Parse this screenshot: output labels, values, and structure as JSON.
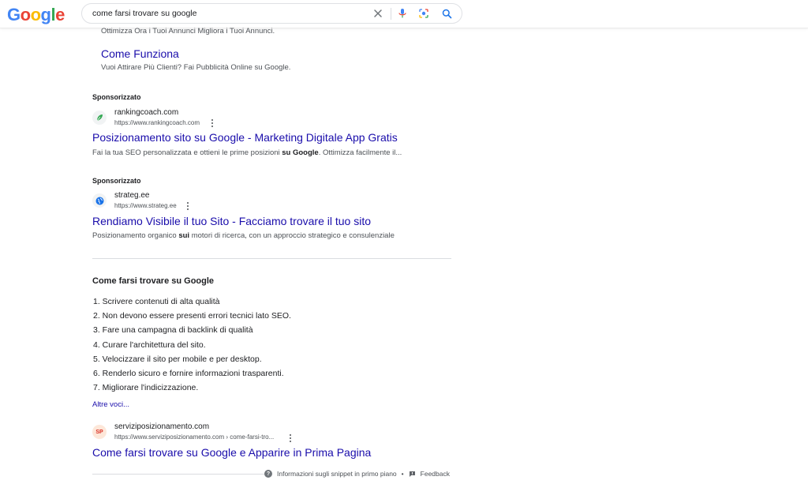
{
  "header": {
    "logo_letters": [
      {
        "char": "G",
        "color": "#4285F4"
      },
      {
        "char": "o",
        "color": "#EA4335"
      },
      {
        "char": "o",
        "color": "#FBBC05"
      },
      {
        "char": "g",
        "color": "#4285F4"
      },
      {
        "char": "l",
        "color": "#34A853"
      },
      {
        "char": "e",
        "color": "#EA4335"
      }
    ],
    "search": {
      "value": "come farsi trovare su google",
      "icons": [
        "clear-icon",
        "microphone-icon",
        "camera-lens-icon",
        "search-icon"
      ]
    }
  },
  "sitelinks": {
    "top_desc": "Ottimizza Ora i Tuoi Annunci Migliora i Tuoi Annunci.",
    "title": "Come Funziona",
    "desc": "Vuoi Attirare Più Clienti? Fai Pubblicità Online su Google."
  },
  "ads": [
    {
      "sponsored": "Sponsorizzato",
      "site": "rankingcoach.com",
      "url": "https://www.rankingcoach.com",
      "title": "Posizionamento sito su Google - Marketing Digitale App Gratis",
      "desc_pre": "Fai la tua SEO personalizzata e ottieni le prime posizioni ",
      "desc_bold": "su Google",
      "desc_post": ". Ottimizza facilmente il...",
      "favicon": "leaf-icon",
      "favicon_color": "#34A853"
    },
    {
      "sponsored": "Sponsorizzato",
      "site": "strateg.ee",
      "url": "https://www.strateg.ee",
      "title": "Rendiamo Visibile il tuo Sito - Facciamo trovare il tuo sito",
      "desc_pre": "Posizionamento organico ",
      "desc_bold": "sui",
      "desc_post": " motori di ricerca, con un approccio strategico e consulenziale",
      "favicon": "globe-icon",
      "favicon_color": "#1a73e8"
    }
  ],
  "snippet": {
    "heading": "Come farsi trovare su Google",
    "steps": [
      "1. Scrivere contenuti di alta qualità",
      "2. Non devono essere presenti errori tecnici lato SEO.",
      "3. Fare una campagna di backlink di qualità",
      "4. Curare l'architettura del sito.",
      "5. Velocizzare il sito per mobile e per desktop.",
      "6. Renderlo sicuro e fornire informazioni trasparenti.",
      "7. Migliorare l'indicizzazione."
    ],
    "more": "Altre voci...",
    "source": {
      "favicon_text": "SP",
      "site": "serviziposizionamento.com",
      "url": "https://www.serviziposizionamento.com › come-farsi-tro...",
      "title": "Come farsi trovare su Google e Apparire in Prima Pagina"
    },
    "footer": {
      "info": "Informazioni sugli snippet in primo piano",
      "bullet": "•",
      "feedback": "Feedback"
    }
  }
}
